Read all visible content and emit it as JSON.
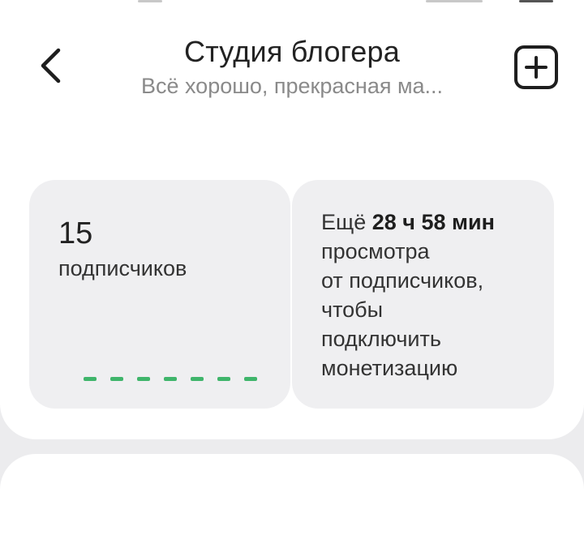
{
  "header": {
    "title": "Студия блогера",
    "subtitle": "Всё хорошо, прекрасная ма...",
    "back_icon": "chevron-left-icon",
    "add_icon": "plus-square-icon"
  },
  "subscribers": {
    "count": "15",
    "label": "подписчиков",
    "progress_segments": 7,
    "progress_color": "#3fb56b"
  },
  "monetization": {
    "prefix": "Ещё",
    "time_value": "28 ч 58 мин",
    "line1": "просмотра",
    "line2": "от подписчиков,",
    "line3": "чтобы",
    "line4": "подключить",
    "line5": "монетизацию"
  },
  "colors": {
    "background": "#ececee",
    "card": "#efeff1",
    "accent_green": "#3fb56b"
  }
}
